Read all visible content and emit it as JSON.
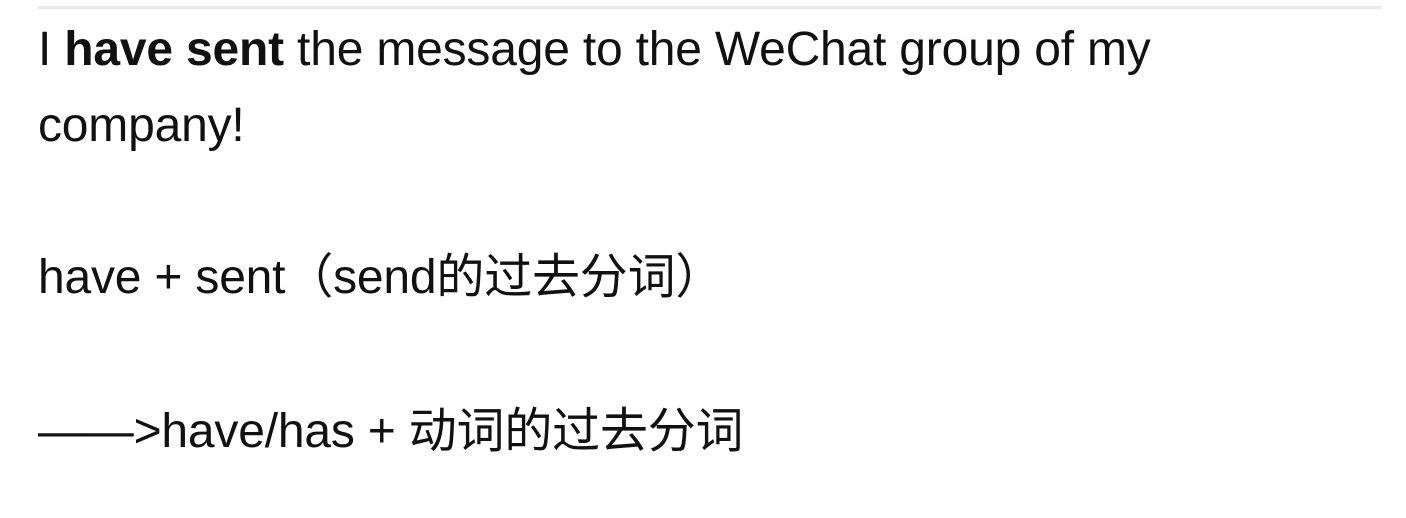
{
  "content": {
    "sentence": {
      "prefix": "I ",
      "bold": "have sent",
      "suffix_line1": " the message to the WeChat group of my",
      "suffix_line2": "company!"
    },
    "explanation": "have + sent（send的过去分词）",
    "rule": "——>have/has + 动词的过去分词"
  }
}
